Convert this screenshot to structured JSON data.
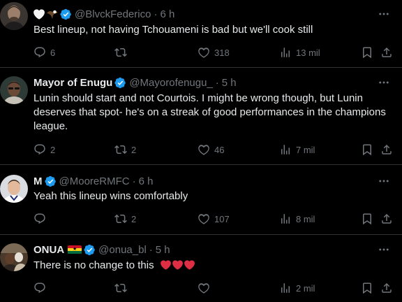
{
  "tweets": [
    {
      "name": "",
      "name_emojis": [
        "white-heart-emoji",
        "eagle-emoji"
      ],
      "handle": "@BlvckFederico",
      "time": "6 h",
      "text": "Best lineup, not having Tchouameni is bad but we'll cook still",
      "replies": "6",
      "retweets": "",
      "likes": "318",
      "views": "13 mil"
    },
    {
      "name": "Mayor of Enugu",
      "handle": "@Mayorofenugu_",
      "time": "5 h",
      "text": "Lunin should start and not Courtois. I might be wrong though, but Lunin deserves that spot- he's on a streak of good performances in the champions league.",
      "replies": "2",
      "retweets": "2",
      "likes": "46",
      "views": "7 mil"
    },
    {
      "name": "M",
      "handle": "@MooreRMFC",
      "time": "6 h",
      "text": "Yeah this lineup wins comfortably",
      "replies": "",
      "retweets": "2",
      "likes": "107",
      "views": "8 mil"
    },
    {
      "name": "ONUA",
      "name_emojis": [
        "ghana-flag-emoji"
      ],
      "handle": "@onua_bl",
      "time": "5 h",
      "text": "There is no change to this",
      "text_emojis": [
        "red-heart-emoji",
        "red-heart-emoji",
        "red-heart-emoji"
      ],
      "replies": "",
      "retweets": "",
      "likes": "",
      "views": "2 mil"
    }
  ],
  "separator": "·",
  "colors": {
    "background": "#000000",
    "text": "#e7e9ea",
    "muted": "#71767b",
    "verified": "#1d9bf0",
    "divider": "#2f3336",
    "heart_red": "#dd2e44"
  },
  "icons": [
    "verified-badge-icon",
    "more-icon",
    "reply-icon",
    "retweet-icon",
    "like-icon",
    "views-icon",
    "bookmark-icon",
    "share-icon"
  ]
}
